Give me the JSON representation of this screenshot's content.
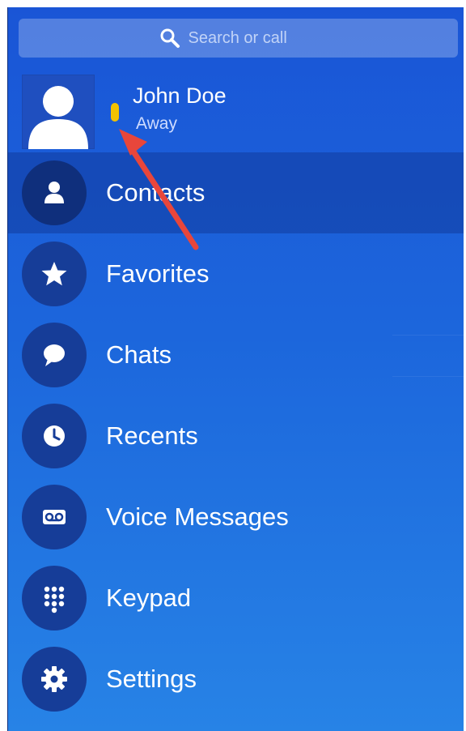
{
  "search": {
    "placeholder": "Search or call"
  },
  "profile": {
    "name": "John Doe",
    "status": "Away",
    "status_color": "#f3c200"
  },
  "menu": {
    "items": [
      {
        "label": "Contacts",
        "icon": "person-icon",
        "selected": true
      },
      {
        "label": "Favorites",
        "icon": "star-icon",
        "selected": false
      },
      {
        "label": "Chats",
        "icon": "chat-bubble-icon",
        "selected": false
      },
      {
        "label": "Recents",
        "icon": "clock-icon",
        "selected": false
      },
      {
        "label": "Voice Messages",
        "icon": "voicemail-icon",
        "selected": false
      },
      {
        "label": "Keypad",
        "icon": "keypad-icon",
        "selected": false
      },
      {
        "label": "Settings",
        "icon": "gear-icon",
        "selected": false
      }
    ]
  },
  "annotation": {
    "arrow_color": "#e8463b",
    "icon": "arrow-annotation-icon"
  },
  "colors": {
    "accent": "#1a55d6",
    "icon_circle": "#163d98",
    "selected_row": "#0f2f7c"
  }
}
